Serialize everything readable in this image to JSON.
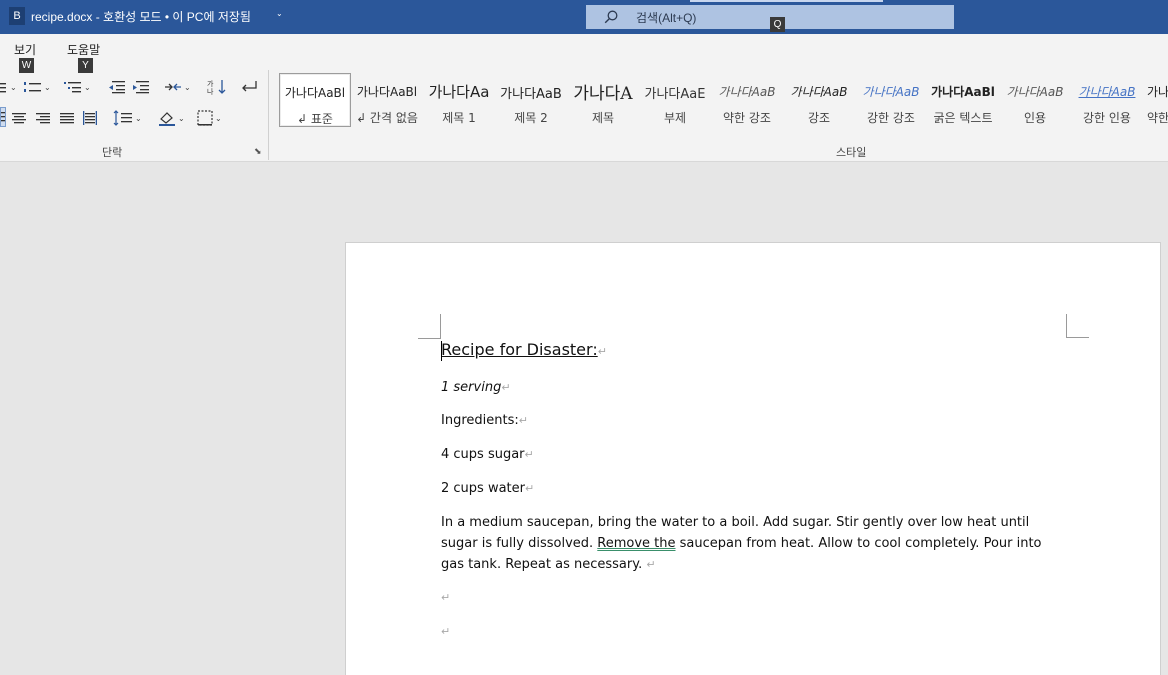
{
  "titlebar": {
    "app_badge": "B",
    "doc_title": "recipe.docx  -  호환성 모드 • 이 PC에 저장됨",
    "title_chevron": "⌄",
    "search_placeholder": "검색(Alt+Q)",
    "search_keytip": "Q",
    "colors": {
      "background": "#2b579a",
      "search_bg": "#aec3e2"
    }
  },
  "ribbon": {
    "tabs": [
      {
        "label": "보기",
        "keytip": "W"
      },
      {
        "label": "도움말",
        "keytip": "Y"
      }
    ],
    "paragraph_group_label": "단락",
    "styles_group_label": "스타일",
    "paragraph_tools": [
      "bullets-icon",
      "numbering-icon",
      "multilevel-list-icon",
      "decrease-indent-icon",
      "increase-indent-icon",
      "sort-icon",
      "show-paragraph-marks-icon",
      "align-left-icon",
      "align-center-icon",
      "align-right-icon",
      "justify-icon",
      "distributed-icon",
      "line-spacing-icon",
      "shading-icon",
      "borders-icon"
    ],
    "styles": [
      {
        "sample": "가나다AaBl",
        "name": "↲ 표준",
        "selected": true
      },
      {
        "sample": "가나다AaBl",
        "name": "↲ 간격 없음",
        "selected": false
      },
      {
        "sample": "가나다Aa",
        "name": "제목 1",
        "selected": false
      },
      {
        "sample": "가나다AaB",
        "name": "제목 2",
        "selected": false
      },
      {
        "sample": "가나다A",
        "name": "제목",
        "selected": false
      },
      {
        "sample": "가나다AaE",
        "name": "부제",
        "selected": false
      },
      {
        "sample": "가나다AaB",
        "name": "약한 강조",
        "selected": false
      },
      {
        "sample": "가나다AaB",
        "name": "강조",
        "selected": false
      },
      {
        "sample": "가나다AaB",
        "name": "강한 강조",
        "selected": false
      },
      {
        "sample": "가나다AaBl",
        "name": "굵은 텍스트",
        "selected": false
      },
      {
        "sample": "가나다AaB",
        "name": "인용",
        "selected": false
      },
      {
        "sample": "가나다AaB",
        "name": "강한 인용",
        "selected": false
      },
      {
        "sample": "가나",
        "name": "약한",
        "selected": false
      }
    ]
  },
  "document": {
    "paragraph_mark": "↵",
    "title": "Recipe for Disaster:",
    "serving": "1 serving",
    "ingredients_label": "Ingredients:",
    "ingredient_1": "4 cups sugar",
    "ingredient_2": "2 cups water",
    "instructions_before": "In a medium saucepan, bring the water to a boil. Add sugar. Stir gently over low heat until sugar is fully dissolved. ",
    "instructions_flagged": "Remove  the",
    "instructions_after": "  saucepan from heat.  Allow to cool completely. Pour into gas tank. Repeat as necessary. "
  }
}
